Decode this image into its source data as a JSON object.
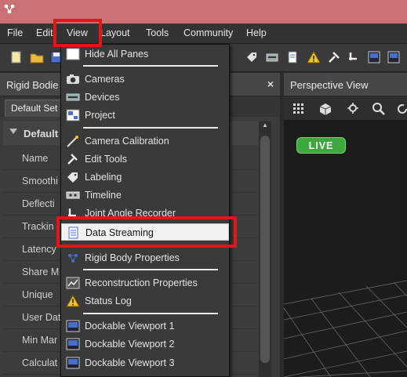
{
  "menubar": {
    "items": [
      "File",
      "Edit",
      "View",
      "Layout",
      "Tools",
      "Community",
      "Help"
    ]
  },
  "left_panel": {
    "title": "Rigid Bodie",
    "close_label": "×",
    "tab_label": "Default Set",
    "group_label": "Default",
    "properties": [
      "Name",
      "Smoothi",
      "Deflecti",
      "Trackin",
      "Latency",
      "Share M",
      "Unique",
      "User Dat",
      "Min Mar",
      "Calculat"
    ]
  },
  "right_panel": {
    "title": "Perspective View",
    "live_label": "LIVE"
  },
  "view_menu": {
    "items": [
      {
        "label": "Hide All Panes",
        "icon": "pane-icon"
      },
      {
        "label": "Cameras",
        "icon": "camera-icon"
      },
      {
        "label": "Devices",
        "icon": "devices-icon"
      },
      {
        "label": "Project",
        "icon": "project-icon"
      },
      {
        "label": "Camera Calibration",
        "icon": "calibration-wand-icon"
      },
      {
        "label": "Edit Tools",
        "icon": "edit-tools-icon"
      },
      {
        "label": "Labeling",
        "icon": "labeling-icon"
      },
      {
        "label": "Timeline",
        "icon": "timeline-icon"
      },
      {
        "label": "Joint Angle Recorder",
        "icon": "joint-angle-icon"
      },
      {
        "label": "Data Streaming",
        "icon": "data-streaming-icon"
      },
      {
        "label": "Rigid Body Properties",
        "icon": "rigid-body-icon"
      },
      {
        "label": "Reconstruction Properties",
        "icon": "reconstruction-icon"
      },
      {
        "label": "Status Log",
        "icon": "warning-icon"
      },
      {
        "label": "Dockable Viewport 1",
        "icon": "viewport-icon"
      },
      {
        "label": "Dockable Viewport 2",
        "icon": "viewport-icon"
      },
      {
        "label": "Dockable Viewport 3",
        "icon": "viewport-icon"
      }
    ],
    "highlighted": "Data Streaming"
  },
  "colors": {
    "titlebar": "#c97174",
    "highlight_box": "#e4141a",
    "live": "#3fa73f"
  }
}
